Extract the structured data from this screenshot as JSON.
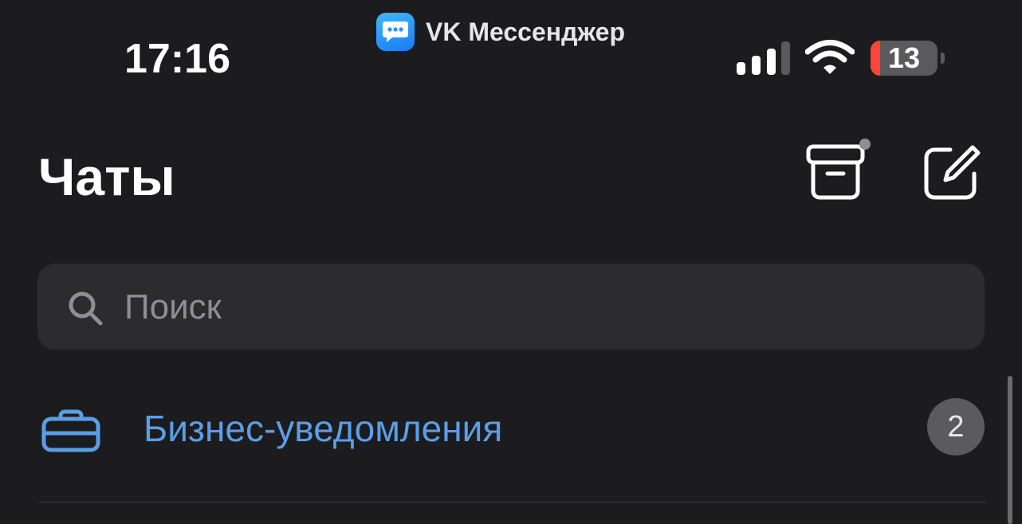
{
  "status_bar": {
    "time": "17:16",
    "app_name": "VK Мессенджер",
    "battery": "13",
    "colors": {
      "battery_low": "#ff453a",
      "app_icon": "#2a8ff7"
    }
  },
  "header": {
    "title": "Чаты",
    "archive_icon": "archive-box-icon",
    "compose_icon": "compose-icon"
  },
  "search": {
    "placeholder": "Поиск",
    "value": ""
  },
  "chat_list": {
    "items": [
      {
        "label": "Бизнес-уведомления",
        "icon": "briefcase-icon",
        "badge": "2",
        "accent": "#5a9ee8"
      }
    ]
  }
}
